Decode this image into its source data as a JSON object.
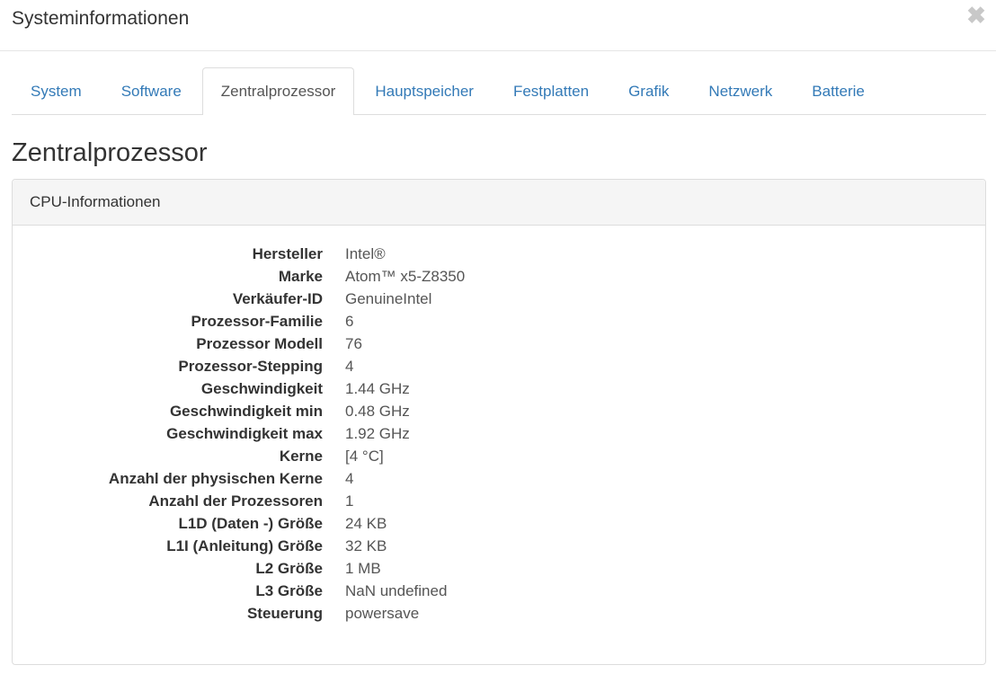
{
  "dialog": {
    "title": "Systeminformationen",
    "close_glyph": "✖"
  },
  "tabs": [
    {
      "label": "System",
      "active": false
    },
    {
      "label": "Software",
      "active": false
    },
    {
      "label": "Zentralprozessor",
      "active": true
    },
    {
      "label": "Hauptspeicher",
      "active": false
    },
    {
      "label": "Festplatten",
      "active": false
    },
    {
      "label": "Grafik",
      "active": false
    },
    {
      "label": "Netzwerk",
      "active": false
    },
    {
      "label": "Batterie",
      "active": false
    }
  ],
  "section": {
    "title": "Zentralprozessor"
  },
  "panel": {
    "heading": "CPU-Informationen",
    "rows": [
      {
        "label": "Hersteller",
        "value": "Intel®"
      },
      {
        "label": "Marke",
        "value": "Atom™ x5-Z8350"
      },
      {
        "label": "Verkäufer-ID",
        "value": "GenuineIntel"
      },
      {
        "label": "Prozessor-Familie",
        "value": "6"
      },
      {
        "label": "Prozessor Modell",
        "value": "76"
      },
      {
        "label": "Prozessor-Stepping",
        "value": "4"
      },
      {
        "label": "Geschwindigkeit",
        "value": "1.44 GHz"
      },
      {
        "label": "Geschwindigkeit min",
        "value": "0.48 GHz"
      },
      {
        "label": "Geschwindigkeit max",
        "value": "1.92 GHz"
      },
      {
        "label": "Kerne",
        "value": "[4 °C]"
      },
      {
        "label": "Anzahl der physischen Kerne",
        "value": "4"
      },
      {
        "label": "Anzahl der Prozessoren",
        "value": "1"
      },
      {
        "label": "L1D (Daten -) Größe",
        "value": "24 KB"
      },
      {
        "label": "L1I (Anleitung) Größe",
        "value": "32 KB"
      },
      {
        "label": "L2 Größe",
        "value": "1 MB"
      },
      {
        "label": "L3 Größe",
        "value": "NaN undefined"
      },
      {
        "label": "Steuerung",
        "value": "powersave"
      }
    ]
  },
  "colors": {
    "link": "#337ab7",
    "active_tab_text": "#555555",
    "panel_heading_bg": "#f5f5f5",
    "border": "#dddddd",
    "close_icon": "#c8c8c8"
  }
}
